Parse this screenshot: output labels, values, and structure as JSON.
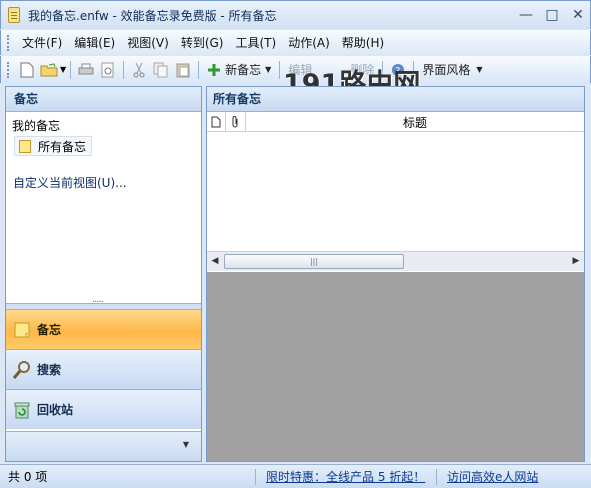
{
  "window": {
    "title": "我的备忘.enfw - 效能备忘录免费版 - 所有备忘"
  },
  "menu": [
    "文件(F)",
    "编辑(E)",
    "视图(V)",
    "转到(G)",
    "工具(T)",
    "动作(A)",
    "帮助(H)"
  ],
  "toolbar": {
    "new_note": "新备忘",
    "edit": "编辑",
    "delete": "删除",
    "ui_style": "界面风格"
  },
  "watermark": "191路由网",
  "left_panel": {
    "header": "备忘",
    "section": "我的备忘",
    "selected_item": "所有备忘",
    "customize": "自定义当前视图(U)...",
    "nav": [
      {
        "label": "备忘",
        "icon": "note-icon"
      },
      {
        "label": "搜索",
        "icon": "search-icon"
      },
      {
        "label": "回收站",
        "icon": "recycle-bin-icon"
      }
    ]
  },
  "right_panel": {
    "header": "所有备忘",
    "columns": [
      "",
      "",
      "标题"
    ]
  },
  "status": {
    "count": "共 0 项",
    "promo": "限时特惠：全线产品 5 折起！",
    "visit": "访问高效e人网站"
  },
  "colors": {
    "accent": "#ffb84a",
    "link": "#0e3a8f",
    "empty_area": "#a1a1a1"
  }
}
